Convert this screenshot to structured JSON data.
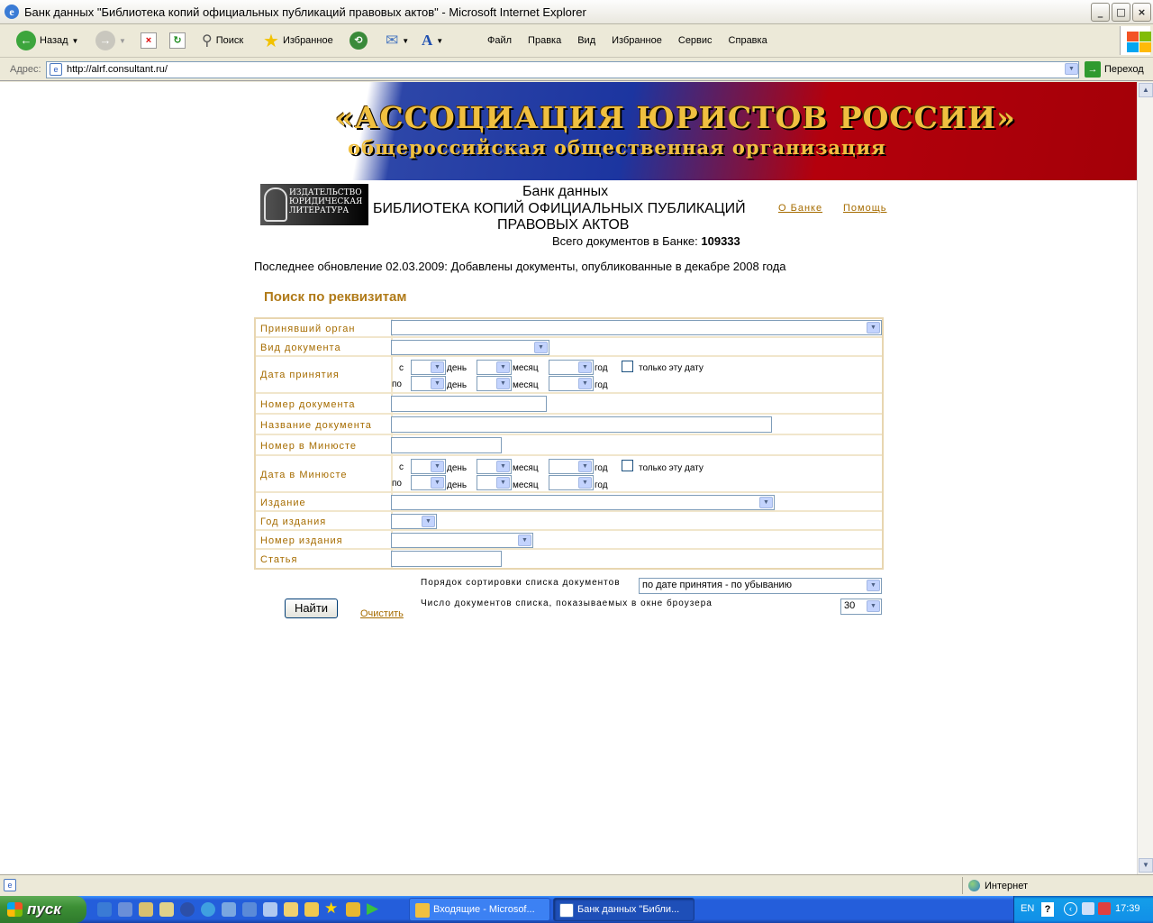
{
  "window": {
    "title": "Банк данных \"Библиотека копий официальных публикаций правовых актов\" - Microsoft Internet Explorer",
    "minimize": "_",
    "maximize": "□",
    "close": "×"
  },
  "toolbar": {
    "back": "Назад",
    "search": "Поиск",
    "favorites": "Избранное",
    "menu": [
      "Файл",
      "Правка",
      "Вид",
      "Избранное",
      "Сервис",
      "Справка"
    ]
  },
  "address": {
    "label": "Адрес:",
    "url": "http://alrf.consultant.ru/",
    "go": "Переход"
  },
  "banner": {
    "line1": "«АССОЦИАЦИЯ ЮРИСТОВ РОССИИ»",
    "line2": "общероссийская общественная организация"
  },
  "logo": {
    "line1": "ИЗДАТЕЛЬСТВО",
    "line2": "ЮРИДИЧЕСКАЯ",
    "line3": "ЛИТЕРАТУРА"
  },
  "header": {
    "bank": "Банк данных",
    "title1": "БИБЛИОТЕКА КОПИЙ ОФИЦИАЛЬНЫХ ПУБЛИКАЦИЙ",
    "title2": "ПРАВОВЫХ АКТОВ",
    "total_label": "Всего документов в Банке:",
    "total_value": "109333",
    "about": "О Банке",
    "help": "Помощь"
  },
  "update_text": "Последнее обновление 02.03.2009: Добавлены документы, опубликованные в декабре 2008 года",
  "search_title": "Поиск по реквизитам",
  "form": {
    "organ": "Принявший орган",
    "doc_type": "Вид документа",
    "date_accept": "Дата принятия",
    "doc_number": "Номер документа",
    "doc_name": "Название документа",
    "minjust_number": "Номер в Минюсте",
    "minjust_date": "Дата в Минюсте",
    "edition": "Издание",
    "edition_year": "Год издания",
    "edition_number": "Номер издания",
    "article": "Статья",
    "from": "с",
    "to": "по",
    "day": "день",
    "month": "месяц",
    "year": "год",
    "only_this_date": "только эту дату"
  },
  "sort": {
    "label": "Порядок сортировки списка документов",
    "value": "по дате принятия - по убыванию",
    "count_label": "Число документов списка, показываемых в окне броузера",
    "count_value": "30"
  },
  "buttons": {
    "find": "Найти",
    "clear": "Очистить"
  },
  "status": {
    "zone": "Интернет"
  },
  "taskbar": {
    "start": "пуск",
    "task1": "Входящие - Microsof...",
    "task2": "Банк данных \"Библи...",
    "lang": "EN",
    "clock": "17:39"
  }
}
